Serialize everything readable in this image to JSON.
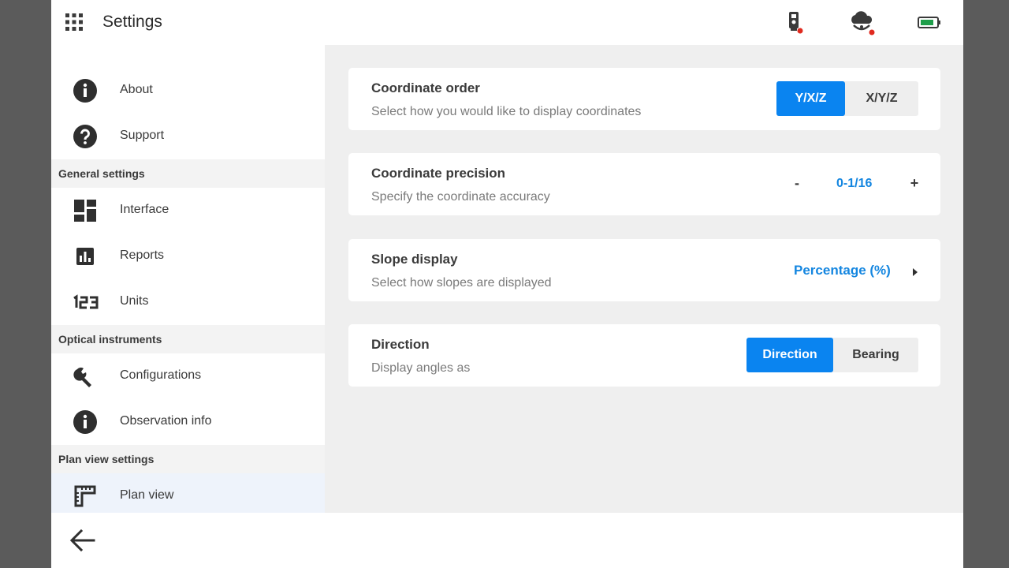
{
  "header": {
    "title": "Settings",
    "apps_icon": "apps-grid-icon",
    "status_icons": [
      "total-station-icon",
      "cloud-connection-icon",
      "battery-icon"
    ],
    "alert_color": "#e02a1f",
    "battery_color": "#1e9e4a"
  },
  "sidebar": {
    "items": [
      {
        "label": "About",
        "icon": "info-icon"
      },
      {
        "label": "Support",
        "icon": "help-icon"
      },
      {
        "label": "Interface",
        "icon": "dashboard-icon"
      },
      {
        "label": "Reports",
        "icon": "bar-chart-icon"
      },
      {
        "label": "Units",
        "icon": "numbers-123-icon"
      },
      {
        "label": "Configurations",
        "icon": "wrench-icon"
      },
      {
        "label": "Observation info",
        "icon": "info-icon"
      },
      {
        "label": "Plan view",
        "icon": "ruler-icon",
        "selected": true
      }
    ],
    "sections": [
      "General settings",
      "Optical instruments",
      "Plan view settings"
    ]
  },
  "main": {
    "coordinate_order": {
      "title": "Coordinate order",
      "description": "Select how you would like to display coordinates",
      "options": [
        "Y/X/Z",
        "X/Y/Z"
      ],
      "selected": "Y/X/Z"
    },
    "coordinate_precision": {
      "title": "Coordinate precision",
      "description": "Specify the coordinate accuracy",
      "minus": "-",
      "value": "0-1/16",
      "plus": "+"
    },
    "slope_display": {
      "title": "Slope display",
      "description": "Select how slopes are displayed",
      "value": "Percentage (%)"
    },
    "direction": {
      "title": "Direction",
      "description": "Display angles as",
      "options": [
        "Direction",
        "Bearing"
      ],
      "selected": "Direction"
    }
  },
  "footer": {
    "back_icon": "arrow-left-icon"
  },
  "colors": {
    "accent": "#0a84f0",
    "link": "#1486e0",
    "background": "#efefef"
  }
}
